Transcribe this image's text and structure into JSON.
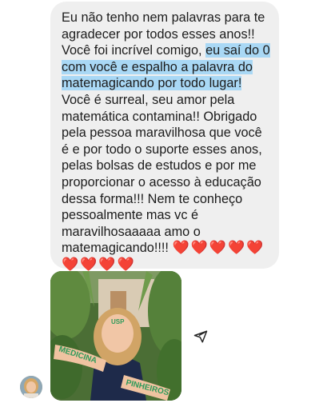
{
  "message": {
    "part1": "Eu não tenho nem palavras para te agradecer por todos esses anos!! Você foi incrível comigo, ",
    "highlight": "eu saí do 0 com você e espalho a palavra do matemagicando por todo lugar!",
    "part2": " Você é surreal, seu amor pela matemática contamina!! Obrigado pela pessoa maravilhosa que você é e por todo o suporte esses anos, pelas bolsas de estudos e por me proporcionar o acesso à educação dessa forma!!! Nem te conheço pessoalmente mas vc é maravilhosaaaaa amo o matemagicando!!!! ",
    "hearts": "❤️❤️❤️❤️❤️❤️❤️❤️❤️"
  },
  "photo": {
    "forehead_text": "USP",
    "left_arm_text": "MEDICINA",
    "right_arm_text": "PINHEIROS"
  },
  "icons": {
    "share": "paper-plane-icon",
    "avatar": "sender-avatar"
  },
  "colors": {
    "bubble_bg": "#efefef",
    "highlight": "#a9d8f5",
    "heart": "#e51c23",
    "arm_text": "#2e9a5a"
  }
}
